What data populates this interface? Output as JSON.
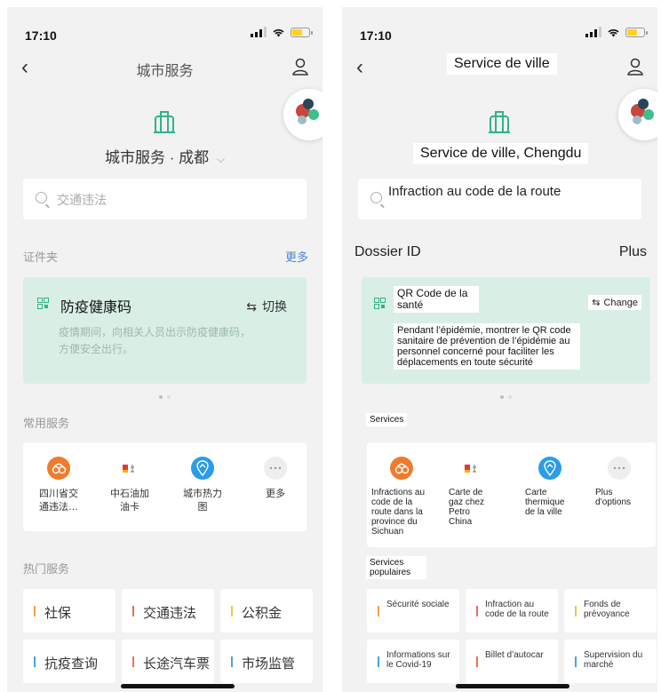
{
  "colors": {
    "bg": "#f2f2f2",
    "card": "#ffffff",
    "health_bg": "#d9efe6",
    "accent_green": "#2fb486",
    "link_blue": "#4a84d6",
    "bar_orange": "#f5a04c",
    "bar_red": "#f06b5a",
    "bar_yellow": "#e9c84a",
    "bar_blue": "#4aa3e0"
  },
  "status_bar": {
    "time": "17:10"
  },
  "left": {
    "nav_title": "城市服务",
    "city_title": "城市服务 · 成都",
    "chevron": "⌵",
    "search_placeholder": "交通违法",
    "id_folder_label": "证件夹",
    "more_label": "更多",
    "health_title": "防疫健康码",
    "health_desc": "疫情期间，向相关人员出示防疫健康码，方便安全出行。",
    "switch_label": "切换",
    "common_services_label": "常用服务",
    "services": [
      {
        "label": "四川省交\n通违法…",
        "icon": "car-violation-icon",
        "color": "#f07b2e"
      },
      {
        "label": "中石油加\n油卡",
        "icon": "gas-card-icon",
        "color": "#ffffff"
      },
      {
        "label": "城市热力\n图",
        "icon": "heatmap-icon",
        "color": "#2a9ce8"
      },
      {
        "label": "更多",
        "icon": "more-dots-icon",
        "color": "#eeeeee"
      }
    ],
    "hot_services_label": "热门服务",
    "hot": [
      {
        "label": "社保",
        "bar": "#f5a04c"
      },
      {
        "label": "交通违法",
        "bar": "#f06b5a"
      },
      {
        "label": "公积金",
        "bar": "#e9c84a"
      },
      {
        "label": "抗疫查询",
        "bar": "#4aa3e0"
      },
      {
        "label": "长途汽车票",
        "bar": "#f06b5a"
      },
      {
        "label": "市场监管",
        "bar": "#4aa3e0"
      }
    ]
  },
  "right": {
    "nav_title": "Service de ville",
    "city_title": "Service de ville, Chengdu",
    "search_placeholder": "Infraction au code de la route",
    "id_folder_label": "Dossier ID",
    "more_label": "Plus",
    "health_title": "QR Code de la santé",
    "health_desc": "Pendant l’épidémie, montrer le QR code sanitaire de prévention de l’épidémie au personnel concerné pour faciliter les déplacements en toute sécurité",
    "switch_label": "Change",
    "common_services_label": "Services",
    "services": [
      {
        "label": "Infractions au code de la route dans la province du Sichuan",
        "icon": "car-violation-icon",
        "color": "#f07b2e"
      },
      {
        "label": "Carte de gaz chez Petro China",
        "icon": "gas-card-icon",
        "color": "#ffffff"
      },
      {
        "label": "Carte thermique de la ville",
        "icon": "heatmap-icon",
        "color": "#2a9ce8"
      },
      {
        "label": "Plus d’options",
        "icon": "more-dots-icon",
        "color": "#eeeeee"
      }
    ],
    "hot_services_label": "Services populaires",
    "hot": [
      {
        "label": "Sécurité sociale",
        "bar": "#f5a04c"
      },
      {
        "label": "Infraction au code de la route",
        "bar": "#f06b5a"
      },
      {
        "label": "Fonds de prévoyance",
        "bar": "#e9c84a"
      },
      {
        "label": "Informations sur le Covid-19",
        "bar": "#4aa3e0"
      },
      {
        "label": "Billet d’autocar",
        "bar": "#f06b5a"
      },
      {
        "label": "Supervision du marché",
        "bar": "#4aa3e0"
      }
    ]
  }
}
